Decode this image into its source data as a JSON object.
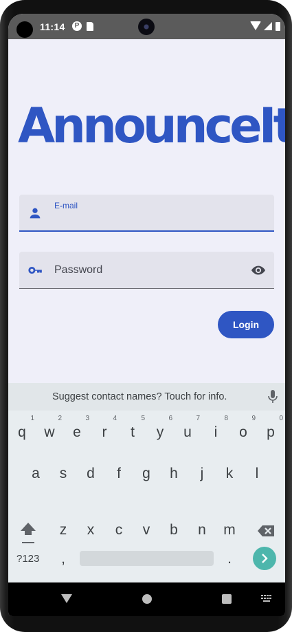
{
  "status_bar": {
    "time": "11:14"
  },
  "app": {
    "logo_text": "AnnounceIt"
  },
  "form": {
    "email": {
      "label": "E-mail",
      "value": ""
    },
    "password": {
      "label": "Password"
    },
    "login_label": "Login"
  },
  "keyboard": {
    "suggestion": "Suggest contact names? Touch for info.",
    "row1": [
      {
        "key": "q",
        "hint": "1"
      },
      {
        "key": "w",
        "hint": "2"
      },
      {
        "key": "e",
        "hint": "3"
      },
      {
        "key": "r",
        "hint": "4"
      },
      {
        "key": "t",
        "hint": "5"
      },
      {
        "key": "y",
        "hint": "6"
      },
      {
        "key": "u",
        "hint": "7"
      },
      {
        "key": "i",
        "hint": "8"
      },
      {
        "key": "o",
        "hint": "9"
      },
      {
        "key": "p",
        "hint": "0"
      }
    ],
    "row2": [
      "a",
      "s",
      "d",
      "f",
      "g",
      "h",
      "j",
      "k",
      "l"
    ],
    "row3": [
      "z",
      "x",
      "c",
      "v",
      "b",
      "n",
      "m"
    ],
    "symbols_label": "?123",
    "comma": ",",
    "period": "."
  },
  "colors": {
    "accent": "#2f56c3",
    "background": "#efeff9",
    "enter_key": "#4db6ac"
  }
}
